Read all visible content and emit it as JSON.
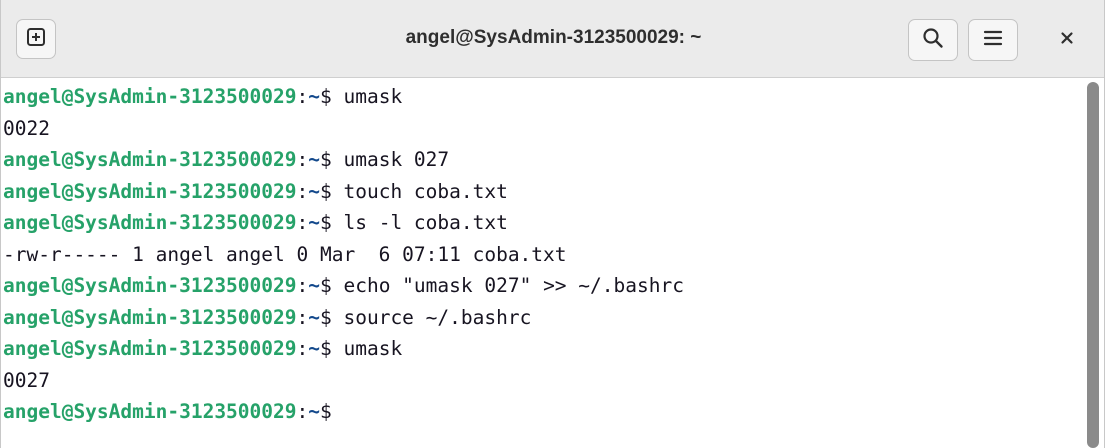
{
  "window": {
    "title": "angel@SysAdmin-3123500029: ~"
  },
  "headerbar": {
    "new_tab_icon": "plus-square-icon",
    "search_icon": "search-icon",
    "menu_icon": "hamburger-menu-icon",
    "close_icon": "close-icon"
  },
  "prompt": {
    "user_host": "angel@SysAdmin-3123500029",
    "separator": ":",
    "dir": "~",
    "symbol": "$ "
  },
  "terminal": {
    "lines": [
      {
        "type": "command",
        "text": "umask"
      },
      {
        "type": "output",
        "text": "0022"
      },
      {
        "type": "command",
        "text": "umask 027"
      },
      {
        "type": "command",
        "text": "touch coba.txt"
      },
      {
        "type": "command",
        "text": "ls -l coba.txt"
      },
      {
        "type": "output",
        "text": "-rw-r----- 1 angel angel 0 Mar  6 07:11 coba.txt"
      },
      {
        "type": "command",
        "text": "echo \"umask 027\" >> ~/.bashrc"
      },
      {
        "type": "command",
        "text": "source ~/.bashrc"
      },
      {
        "type": "command",
        "text": "umask"
      },
      {
        "type": "output",
        "text": "0027"
      },
      {
        "type": "prompt",
        "text": ""
      }
    ]
  },
  "colors": {
    "user_host": "#26a269",
    "dir": "#12488b",
    "text": "#171421",
    "headerbar": "#ebebeb"
  }
}
